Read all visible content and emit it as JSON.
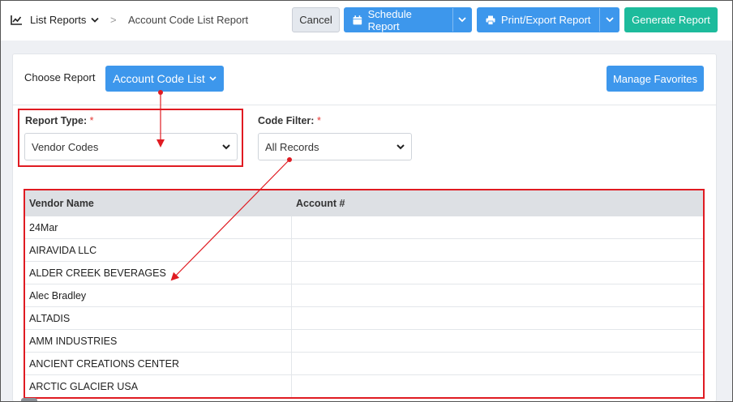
{
  "breadcrumb": {
    "root": "List Reports",
    "separator": ">",
    "current": "Account Code List Report"
  },
  "toolbar": {
    "cancel_label": "Cancel",
    "schedule_label": "Schedule Report",
    "print_label": "Print/Export Report",
    "generate_label": "Generate Report"
  },
  "chooser": {
    "label": "Choose Report",
    "selected": "Account Code List",
    "favorites_label": "Manage Favorites"
  },
  "report_type": {
    "label": "Report Type:",
    "required_mark": "*",
    "value": "Vendor Codes"
  },
  "code_filter": {
    "label": "Code Filter:",
    "required_mark": "*",
    "value": "All Records"
  },
  "table": {
    "columns": [
      "Vendor Name",
      "Account #"
    ],
    "rows": [
      [
        "24Mar",
        ""
      ],
      [
        "AIRAVIDA LLC",
        ""
      ],
      [
        "ALDER CREEK BEVERAGES",
        ""
      ],
      [
        "Alec Bradley",
        ""
      ],
      [
        "ALTADIS",
        ""
      ],
      [
        "AMM INDUSTRIES",
        ""
      ],
      [
        "ANCIENT CREATIONS CENTER",
        ""
      ],
      [
        "ARCTIC GLACIER USA",
        ""
      ]
    ]
  },
  "colors": {
    "primary": "#3d97ec",
    "success": "#1dbb9c",
    "annotation": "#e01b22"
  },
  "icons": {
    "breadcrumb": "line-chart-icon",
    "schedule": "calendar-icon",
    "print": "printer-icon"
  }
}
